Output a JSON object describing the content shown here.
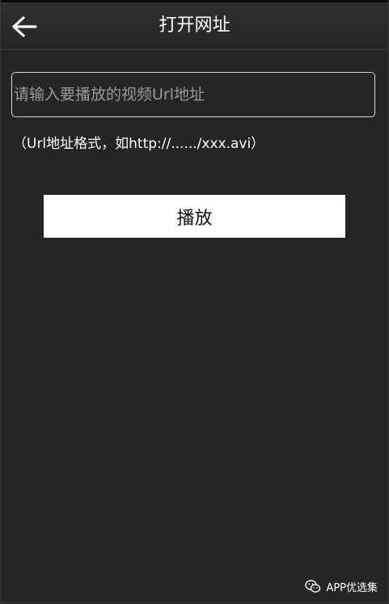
{
  "header": {
    "title": "打开网址",
    "back_icon": "arrow-left-icon"
  },
  "url_input": {
    "value": "",
    "placeholder": "请输入要播放的视频Url地址"
  },
  "hint": {
    "text": "（Url地址格式，如http://....../xxx.avi）"
  },
  "play_button": {
    "label": "播放"
  },
  "watermark": {
    "icon": "wechat-icon",
    "text": "APP优选集"
  },
  "colors": {
    "background": "#252527",
    "header": "#2c2c2e",
    "button": "#ffffff",
    "input_border": "#d8d8d8",
    "placeholder": "#9a9a9a"
  }
}
